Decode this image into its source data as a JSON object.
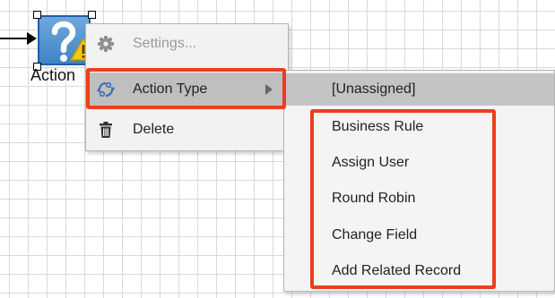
{
  "canvas": {
    "grid_color": "#d9d9d9",
    "background": "#ffffff"
  },
  "node": {
    "label": "Action",
    "icon": "question-mark-icon",
    "badge_icon": "warning-icon",
    "fill": "#3d85c6"
  },
  "context_menu": {
    "items": [
      {
        "label": "Settings...",
        "icon": "gear-icon",
        "disabled": true
      },
      {
        "label": "Action Type",
        "icon": "action-type-icon",
        "has_submenu": true,
        "highlighted": true
      },
      {
        "label": "Delete",
        "icon": "trash-icon"
      }
    ]
  },
  "action_type_submenu": {
    "items": [
      {
        "label": "[Unassigned]",
        "selected": true
      },
      {
        "label": "Business Rule"
      },
      {
        "label": "Assign User"
      },
      {
        "label": "Round Robin"
      },
      {
        "label": "Change Field"
      },
      {
        "label": "Add Related Record"
      }
    ]
  },
  "colors": {
    "highlight": "#ec3e1e",
    "menu_bg": "#f2f2f2",
    "menu_hover": "#bfbfbf"
  }
}
